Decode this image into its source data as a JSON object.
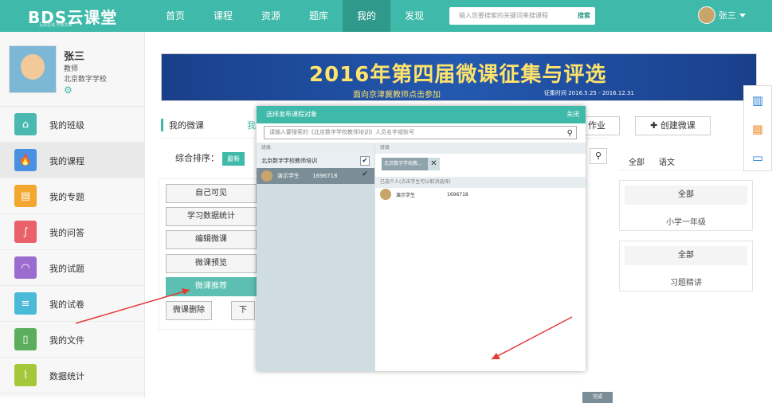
{
  "header": {
    "logo": "BDS云课堂",
    "logo_sub": "互动在线 开放共享",
    "nav": [
      "首页",
      "课程",
      "资源",
      "题库",
      "我的",
      "发现"
    ],
    "active_nav": "我的",
    "search_placeholder": "输入您要搜索的关键词来搜课程",
    "search_button": "搜索",
    "user_name": "张三"
  },
  "profile": {
    "name": "张三",
    "role": "教师",
    "school": "北京数字学校"
  },
  "sidebar": {
    "items": [
      {
        "label": "我的班级",
        "color": "#4bb9b0",
        "icon": "⌂"
      },
      {
        "label": "我的课程",
        "color": "#4a90e2",
        "icon": "🔥"
      },
      {
        "label": "我的专题",
        "color": "#f3a731",
        "icon": "▤"
      },
      {
        "label": "我的问答",
        "color": "#e8616b",
        "icon": "∫"
      },
      {
        "label": "我的试题",
        "color": "#9b6ccf",
        "icon": "◠"
      },
      {
        "label": "我的试卷",
        "color": "#4bb9d8",
        "icon": "≡"
      },
      {
        "label": "我的文件",
        "color": "#5cae5c",
        "icon": "▯"
      },
      {
        "label": "数据统计",
        "color": "#a5c83a",
        "icon": "⌇"
      }
    ]
  },
  "banner": {
    "title": "2016年第四届微课征集与评选",
    "subtitle": "面向京津冀教师点击参加",
    "dates": "征集时间 2016.5.25 - 2016.12.31"
  },
  "main": {
    "tab_mine": "我的微课",
    "tab_other": "我",
    "homework": "作业",
    "create": "创建微课",
    "sort_label": "综合排序：",
    "sort_latest": "最新",
    "actions": {
      "visible": "自己可见",
      "stats": "学习数据统计",
      "edit": "编辑微课",
      "preview": "微课预览",
      "recommend": "微课推荐",
      "delete": "微课删除",
      "more": "下"
    }
  },
  "right": {
    "tab_all": "全部",
    "tab_chinese": "语文",
    "cards": [
      {
        "head": "全部",
        "body": "小学一年级"
      },
      {
        "head": "全部",
        "body": "习题精讲"
      }
    ]
  },
  "dialog": {
    "title": "选择发布课程对象",
    "close": "关闭",
    "search_placeholder": "请输入要搜索的《北京数字学校教师培训》人员名字或账号",
    "left_header": "班级",
    "class_name": "北京数字学校教师培训",
    "student_name": "演示学生",
    "student_id": "1696718",
    "right_header": "班级",
    "selected_class": "北京数字学校教...",
    "selected_individual_header": "已选个人(点击学生可以取消选择)",
    "selected_student_name": "演示学生",
    "selected_student_id": "1696718",
    "done": "完成"
  }
}
